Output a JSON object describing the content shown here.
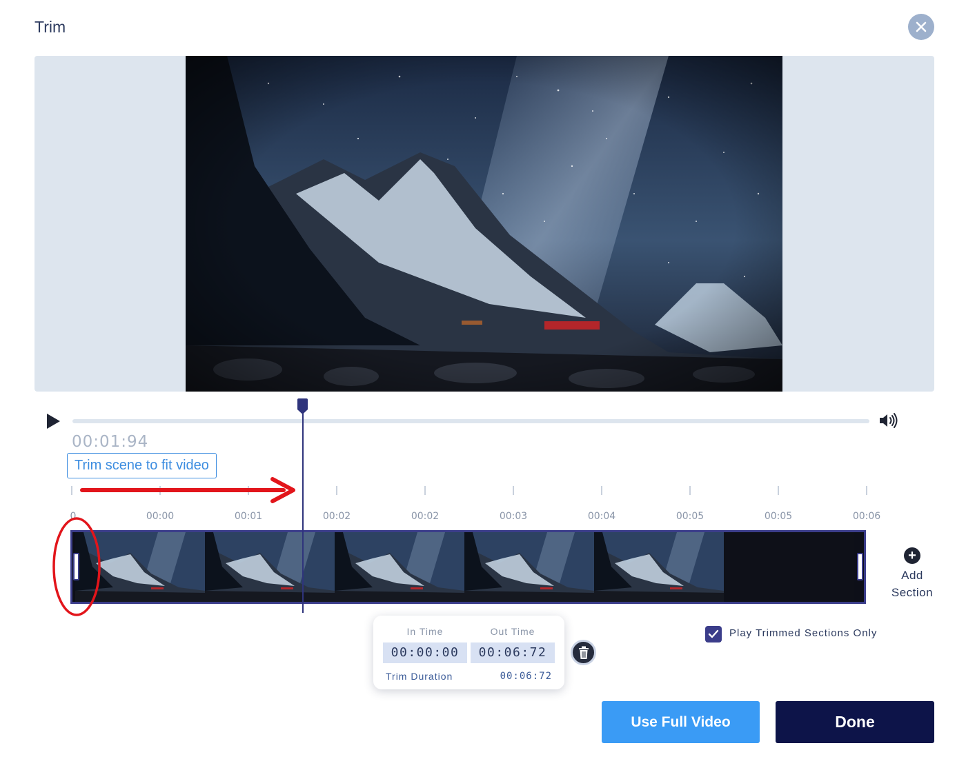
{
  "dialog": {
    "title": "Trim",
    "close_icon": "close-icon"
  },
  "player": {
    "play_icon": "play-icon",
    "volume_icon": "volume-icon",
    "current_time": "00:01:94"
  },
  "annotation": {
    "callout_text": "Trim scene to fit video"
  },
  "ruler": {
    "labels": [
      "0",
      "00:00",
      "00:01",
      "00:02",
      "00:02",
      "00:03",
      "00:04",
      "00:05",
      "00:05",
      "00:06"
    ]
  },
  "timeline": {
    "add_section_label_line1": "Add",
    "add_section_label_line2": "Section"
  },
  "trim_popover": {
    "in_time_label": "In Time",
    "out_time_label": "Out Time",
    "in_time_value": "00:00:00",
    "out_time_value": "00:06:72",
    "duration_label": "Trim Duration",
    "duration_value": "00:06:72"
  },
  "options": {
    "play_trimmed_only_label": "Play Trimmed Sections Only",
    "play_trimmed_only_checked": true
  },
  "actions": {
    "use_full_video_label": "Use Full Video",
    "done_label": "Done"
  },
  "colors": {
    "accent_blue": "#3a9bf5",
    "navy": "#0d1449",
    "timeline_border": "#3b3d8a",
    "annotation_red": "#e2151b"
  }
}
